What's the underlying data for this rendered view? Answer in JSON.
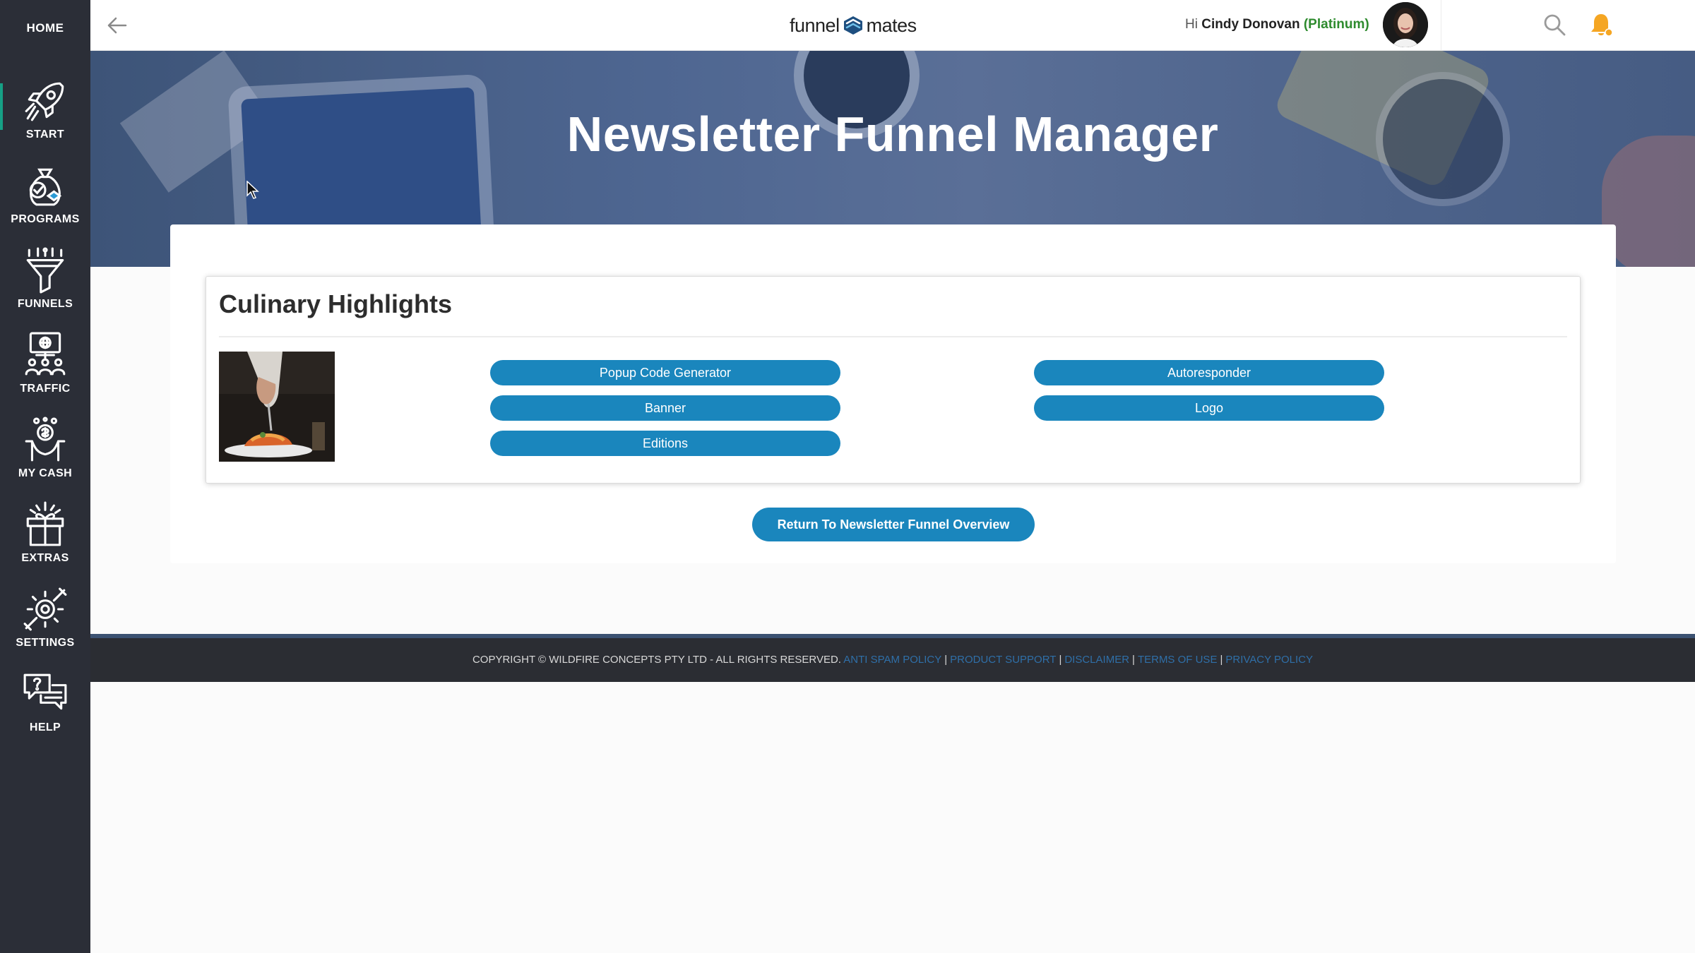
{
  "sidebar": {
    "home_label": "HOME",
    "items": [
      {
        "label": "START",
        "icon": "rocket-icon"
      },
      {
        "label": "PROGRAMS",
        "icon": "money-bag-icon"
      },
      {
        "label": "FUNNELS",
        "icon": "funnel-icon"
      },
      {
        "label": "TRAFFIC",
        "icon": "traffic-network-icon"
      },
      {
        "label": "MY CASH",
        "icon": "cash-hand-icon"
      },
      {
        "label": "EXTRAS",
        "icon": "gift-icon"
      },
      {
        "label": "SETTINGS",
        "icon": "gear-tools-icon"
      },
      {
        "label": "HELP",
        "icon": "chat-help-icon"
      }
    ]
  },
  "header": {
    "logo_left": "funnel",
    "logo_right": "mates",
    "greeting_prefix": "Hi",
    "user_name": "Cindy Donovan",
    "plan": "(Platinum)"
  },
  "hero": {
    "title": "Newsletter Funnel Manager"
  },
  "funnel": {
    "title": "Culinary Highlights",
    "buttons": [
      {
        "label": "Popup Code Generator"
      },
      {
        "label": "Autoresponder"
      },
      {
        "label": "Banner"
      },
      {
        "label": "Logo"
      },
      {
        "label": "Editions"
      }
    ]
  },
  "return_button": "Return To Newsletter Funnel Overview",
  "footer": {
    "copyright": "COPYRIGHT © WILDFIRE CONCEPTS PTY LTD - ALL RIGHTS RESERVED.",
    "links": [
      "ANTI SPAM POLICY",
      "PRODUCT SUPPORT",
      "DISCLAIMER",
      "TERMS OF USE",
      "PRIVACY POLICY"
    ]
  },
  "colors": {
    "sidebar_bg": "#2b2e37",
    "accent_blue": "#1a86bd",
    "plan_green": "#2e8b2e",
    "bell_orange": "#f5a623",
    "footer_bg": "#2b2d33",
    "footer_link": "#2f6fa8"
  }
}
